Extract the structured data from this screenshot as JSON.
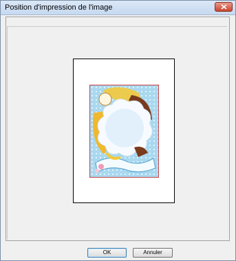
{
  "dialog": {
    "title": "Position d'impression de l'image"
  },
  "buttons": {
    "ok_label": "OK",
    "cancel_label": "Annuler"
  },
  "icons": {
    "close": "close-icon"
  },
  "colors": {
    "image_border": "#c94040",
    "close_button": "#c8452f"
  }
}
